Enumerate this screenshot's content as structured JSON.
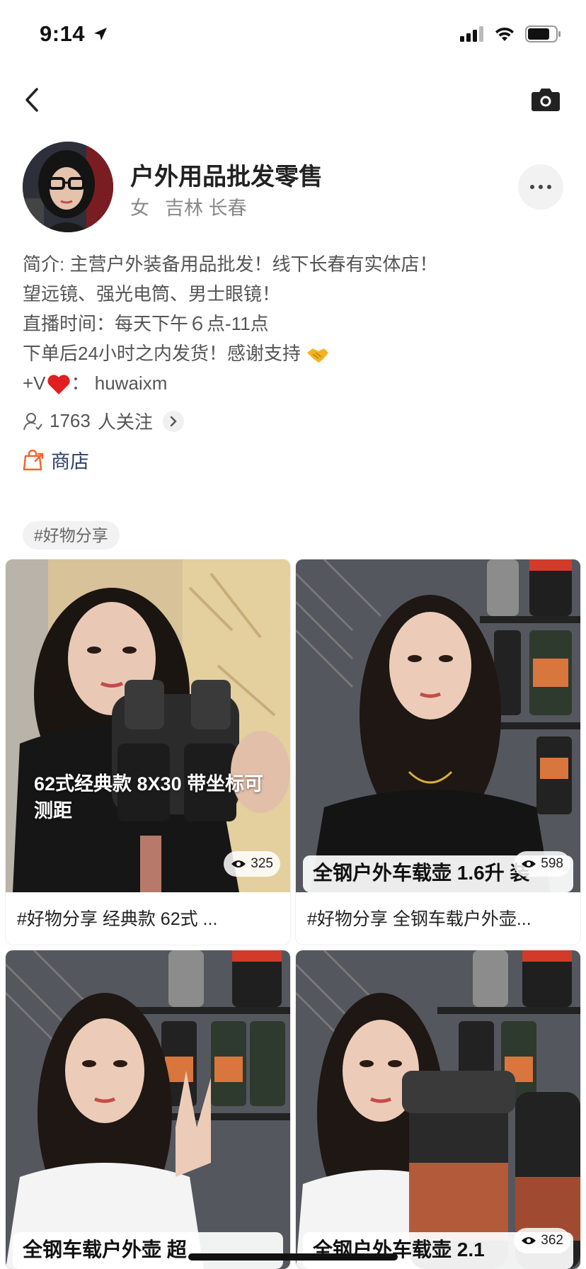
{
  "status_bar": {
    "time": "9:14"
  },
  "profile": {
    "name": "户外用品批发零售",
    "gender": "女",
    "location": "吉林 长春"
  },
  "bio": [
    "简介: 主营户外装备用品批发！线下长春有实体店！",
    "望远镜、强光电筒、男士眼镜！",
    "直播时间：每天下午６点-11点",
    "下单后24小时之内发货！感谢支持",
    "+V",
    "：  huwaixm"
  ],
  "followers": {
    "count": "1763",
    "label": "人关注"
  },
  "shop": {
    "label": "商店"
  },
  "topic": {
    "label": "#好物分享"
  },
  "cards": [
    {
      "overlay": "62式经典款 8X30 带坐标可测距",
      "views": "325",
      "caption": "#好物分享 经典款 62式 ..."
    },
    {
      "banner": "全钢户外车载壶 1.6升 装",
      "views": "598",
      "caption": "#好物分享 全钢车载户外壶..."
    },
    {
      "banner": "全钢车载户外壶 超",
      "views": "",
      "caption": ""
    },
    {
      "banner": "全钢户外车载壶 2.1",
      "views": "362",
      "caption": ""
    }
  ],
  "colors": {
    "accent_shop": "#f2642a",
    "heart": "#e02020"
  }
}
